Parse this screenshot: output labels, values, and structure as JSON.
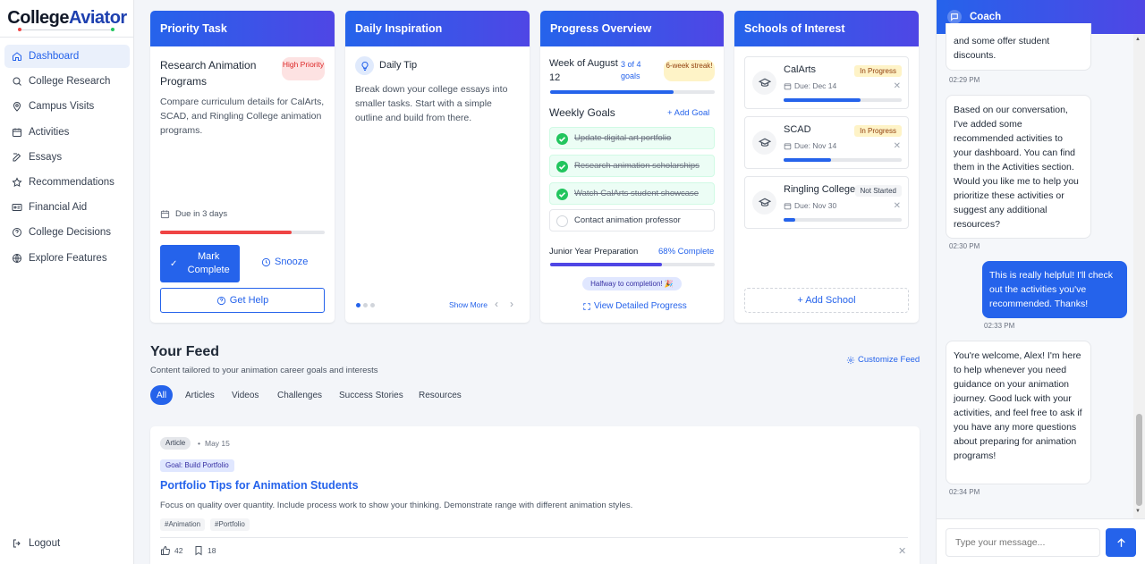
{
  "logo": {
    "part1": "College",
    "part2": "Aviator"
  },
  "nav": {
    "items": [
      {
        "label": "Dashboard",
        "icon": "home-icon"
      },
      {
        "label": "College Research",
        "icon": "search-icon"
      },
      {
        "label": "Campus Visits",
        "icon": "map-pin-icon"
      },
      {
        "label": "Activities",
        "icon": "calendar-icon"
      },
      {
        "label": "Essays",
        "icon": "edit-icon"
      },
      {
        "label": "Recommendations",
        "icon": "star-icon"
      },
      {
        "label": "Financial Aid",
        "icon": "id-card-icon"
      },
      {
        "label": "College Decisions",
        "icon": "help-circle-icon"
      },
      {
        "label": "Explore Features",
        "icon": "globe-icon"
      }
    ],
    "logout": "Logout"
  },
  "priority": {
    "header": "Priority Task",
    "title": "Research Animation Programs",
    "badge": "High Priority",
    "description": "Compare curriculum details for CalArts, SCAD, and Ringling College animation programs.",
    "due": "Due in 3 days",
    "progress": 0.8,
    "mark_complete": "Mark Complete",
    "snooze": "Snooze",
    "get_help": "Get Help"
  },
  "inspiration": {
    "header": "Daily Inspiration",
    "tip_title": "Daily Tip",
    "tip_text": "Break down your college essays into smaller tasks. Start with a simple outline and build from there.",
    "show_more": "Show More"
  },
  "progress": {
    "header": "Progress Overview",
    "week": "Week of August 12",
    "goals_count": "3 of 4 goals",
    "streak": "6-week streak!",
    "week_progress": 0.75,
    "weekly_goals_title": "Weekly Goals",
    "add_goal": "+ Add Goal",
    "goals": [
      {
        "label": "Update digital art portfolio",
        "done": true
      },
      {
        "label": "Research animation scholarships",
        "done": true
      },
      {
        "label": "Watch CalArts student showcase",
        "done": true
      },
      {
        "label": "Contact animation professor",
        "done": false
      }
    ],
    "junior_label": "Junior Year Preparation",
    "junior_complete": "68% Complete",
    "junior_progress": 0.68,
    "halfway": "Halfway to completion! 🎉",
    "detailed": "View Detailed Progress"
  },
  "schools": {
    "header": "Schools of Interest",
    "items": [
      {
        "name": "CalArts",
        "status": "In Progress",
        "due": "Due: Dec 14",
        "progress": 0.65
      },
      {
        "name": "SCAD",
        "status": "In Progress",
        "due": "Due: Nov 14",
        "progress": 0.4
      },
      {
        "name": "Ringling College",
        "status": "Not Started",
        "due": "Due: Nov 30",
        "progress": 0.1
      }
    ],
    "add_school": "+ Add School"
  },
  "feed": {
    "title": "Your Feed",
    "subtitle": "Content tailored to your animation career goals and interests",
    "customize": "Customize Feed",
    "tabs": [
      "All",
      "Articles",
      "Videos",
      "Challenges",
      "Success Stories",
      "Resources"
    ],
    "post": {
      "type": "Article",
      "date": "May 15",
      "goal": "Goal: Build Portfolio",
      "title": "Portfolio Tips for Animation Students",
      "text": "Focus on quality over quantity. Include process work to show your thinking. Demonstrate range with different animation styles.",
      "tags": [
        "#Animation",
        "#Portfolio"
      ],
      "likes": "42",
      "saves": "18"
    }
  },
  "coach": {
    "title": "Coach",
    "messages": [
      {
        "from": "bot",
        "text": "and some offer student discounts.",
        "time": "02:29 PM"
      },
      {
        "from": "bot",
        "text": "Based on our conversation, I've added some recommended activities to your dashboard. You can find them in the Activities section. Would you like me to help you prioritize these activities or suggest any additional resources?",
        "time": "02:30 PM"
      },
      {
        "from": "me",
        "text": "This is really helpful! I'll check out the activities you've recommended. Thanks!",
        "time": "02:33 PM"
      },
      {
        "from": "bot",
        "text": "You're welcome, Alex! I'm here to help whenever you need guidance on your animation journey. Good luck with your activities, and feel free to ask if you have any more questions about preparing for animation programs!",
        "time": "02:34 PM"
      }
    ],
    "placeholder": "Type your message..."
  },
  "colors": {
    "accent": "#2563eb",
    "danger": "#ef4444",
    "success": "#22c55e"
  }
}
